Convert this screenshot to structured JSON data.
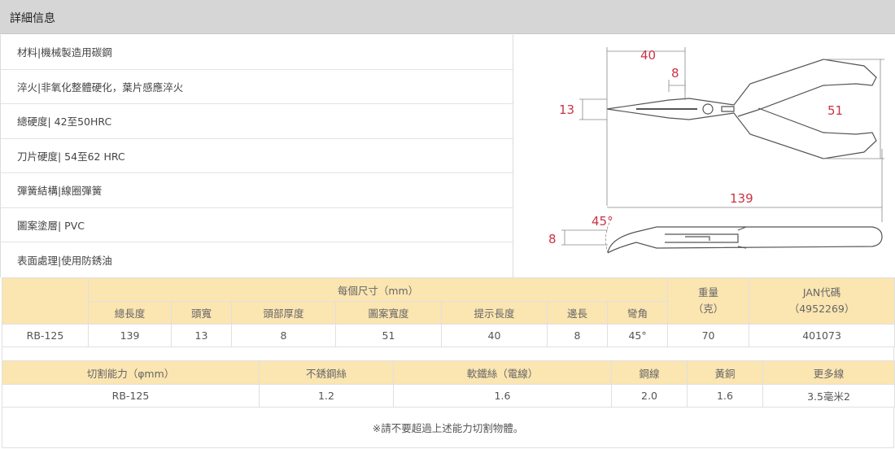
{
  "header": {
    "title": "詳細信息"
  },
  "specs": [
    "材料|機械製造用碳鋼",
    "淬火|非氧化整體硬化，葉片感應淬火",
    "總硬度| 42至50HRC",
    "刀片硬度| 54至62 HRC",
    "彈簧結構|線圈彈簧",
    "圖案塗層| PVC",
    "表面處理|使用防銹油"
  ],
  "diagram": {
    "dims": {
      "a": "40",
      "b": "8",
      "c": "13",
      "d": "51",
      "e": "139",
      "f": "45°",
      "g": "8"
    },
    "line_color": "#555555",
    "dim_color": "#cc3344"
  },
  "dimensions_table": {
    "group_header": "每個尺寸（mm）",
    "weight_header": "重量\n（克）",
    "jan_header": "JAN代碼\n（4952269）",
    "columns": [
      "總長度",
      "頭寬",
      "頭部厚度",
      "圖案寬度",
      "提示長度",
      "邊長",
      "彎角"
    ],
    "row": {
      "model": "RB-125",
      "values": [
        "139",
        "13",
        "8",
        "51",
        "40",
        "8",
        "45°"
      ],
      "weight": "70",
      "jan": "401073"
    }
  },
  "cutting_table": {
    "headers": [
      "切割能力（φmm）",
      "不銹鋼絲",
      "軟鐵絲（電線）",
      "鋼線",
      "黃銅",
      "更多線"
    ],
    "row": [
      "RB-125",
      "1.2",
      "1.6",
      "2.0",
      "1.6",
      "3.5毫米2"
    ]
  },
  "note": "※請不要超過上述能力切割物體。",
  "colors": {
    "header_bg": "#d6d6d6",
    "table_header_bg": "#fbe5b1"
  }
}
